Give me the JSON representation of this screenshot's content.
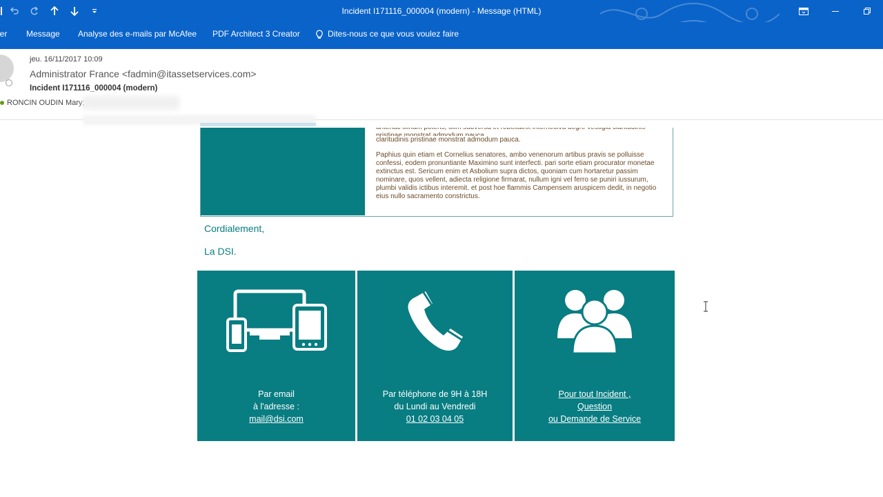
{
  "window": {
    "title": "Incident I171116_000004 (modern)  -  Message (HTML)",
    "accent": "#0a63c9"
  },
  "ribbon": {
    "tabs": [
      "ier",
      "Message",
      "Analyse des e-mails par McAfee",
      "PDF Architect 3 Creator",
      "Dites-nous ce que vous voulez faire"
    ]
  },
  "header": {
    "date": "jeu. 16/11/2017 10:09",
    "from": "Administrator France <fadmin@itassetservices.com>",
    "subject": "Incident I171116_000004 (modern)",
    "to": "RONCIN OUDIN Mary;"
  },
  "body": {
    "lorem_top": "antehac illinam potens, olim subversa et rebellatrix interneciva degre vestigia claritudinis pristinae monstrat admodum pauca.",
    "lorem_main": "Paphius quin etiam et Cornelius senatores, ambo venenorum artibus pravis se polluisse confessi, eodem pronuntiante Maximino sunt interfecti. pari sorte etiam procurator monetae extinctus est. Sericum enim et Asbolium supra dictos, quoniam cum hortaretur passim nominare, quos vellent, adiecta religione firmarat, nullum igni vel ferro se puniri iussurum, plumbi validis ictibus interemit. et post hoe flammis Campensem aruspicem dedit, in negotio eius nullo sacramento constrictus.",
    "closing": "Cordialement,",
    "signature": "La DSI.",
    "teal": "#087d82"
  },
  "tiles": [
    {
      "line1": "Par email",
      "line2": "à l'adresse :",
      "link": "mail@dsi.com"
    },
    {
      "line1": "Par téléphone de 9H à 18H",
      "line2": "du Lundi au Vendredi",
      "link": "01 02 03 04 05"
    },
    {
      "link1": "Pour tout Incident ,",
      "link2": "Question",
      "link3": "ou Demande de Service"
    }
  ]
}
